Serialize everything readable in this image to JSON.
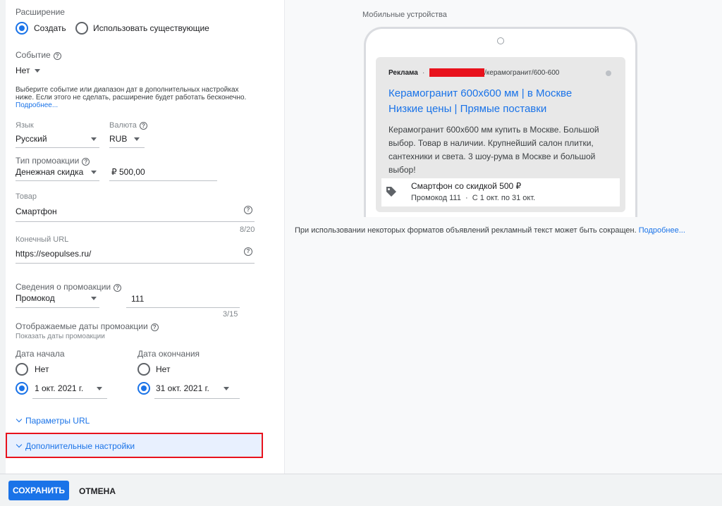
{
  "form": {
    "extension_label": "Расширение",
    "extension_options": [
      "Создать",
      "Использовать существующие"
    ],
    "event_label": "Событие",
    "event_value": "Нет",
    "event_help": "Выберите событие или диапазон дат в дополнительных настройках ниже. Если этого не сделать, расширение будет работать бесконечно.",
    "event_help_link": "Подробнее...",
    "language_label": "Язык",
    "language_value": "Русский",
    "currency_label": "Валюта",
    "currency_value": "RUB",
    "promo_type_label": "Тип промоакции",
    "promo_type_value": "Денежная скидка",
    "discount_value": "₽ 500,00",
    "item_label": "Товар",
    "item_value": "Смартфон",
    "item_counter": "8/20",
    "final_url_label": "Конечный URL",
    "final_url_value": "https://seopulses.ru/",
    "promo_details_label": "Сведения о промоакции",
    "promo_details_value": "Промокод",
    "promo_code_value": "111",
    "promo_code_counter": "3/15",
    "promo_dates_label": "Отображаемые даты промоакции",
    "promo_dates_sub": "Показать даты промоакции",
    "start_date_label": "Дата начала",
    "end_date_label": "Дата окончания",
    "none_option": "Нет",
    "start_date_value": "1 окт. 2021 г.",
    "end_date_value": "31 окт. 2021 г.",
    "url_params_link": "Параметры URL",
    "advanced_link": "Дополнительные настройки"
  },
  "preview": {
    "title": "Мобильные устройства",
    "ad_label": "Реклама",
    "ad_url_path": "/керамогранит/600-600",
    "headline_line1": "Керамогранит 600x600 мм | в Москве",
    "headline_line2": "Низкие цены | Прямые поставки",
    "description": "Керамогранит 600x600 мм купить в Москве. Большой выбор. Товар в наличии. Крупнейший салон плитки, сантехники и света. 3 шоу-рума в Москве и большой выбор!",
    "promo_title": "Смартфон со скидкой 500 ₽",
    "promo_details": "Промокод 111  ·  С 1 окт. по 31 окт.",
    "note": "При использовании некоторых форматов объявлений рекламный текст может быть сокращен.",
    "note_link": "Подробнее..."
  },
  "footer": {
    "save_label": "СОХРАНИТЬ",
    "cancel_label": "ОТМЕНА"
  },
  "colors": {
    "accent": "#1a73e8",
    "redaction": "#e8121c",
    "highlight_border": "#e8121c"
  }
}
